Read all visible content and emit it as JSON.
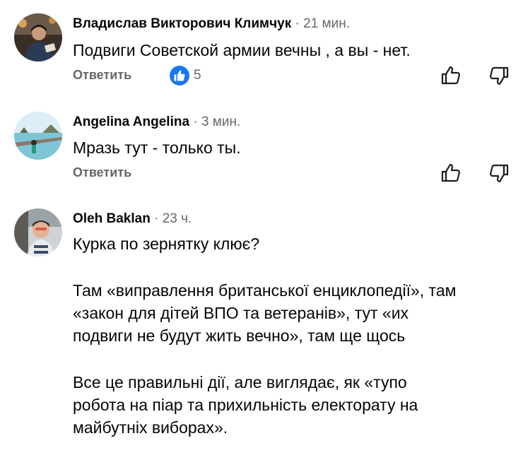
{
  "comments": [
    {
      "author": "Владислав Викторович Климчук",
      "separator": "·",
      "time": "21 мин.",
      "text": "Подвиги Советской армии вечны , а вы - нет.",
      "reply_label": "Ответить",
      "reaction_count": "5",
      "reaction_icon": "like-icon",
      "avatar_icon": "user-photo"
    },
    {
      "author": "Angelina Angelina",
      "separator": "·",
      "time": "3 мин.",
      "text": "Мразь тут - только ты.",
      "reply_label": "Ответить",
      "avatar_icon": "beach-photo"
    },
    {
      "author": "Oleh Baklan",
      "separator": "·",
      "time": "23 ч.",
      "paragraphs": [
        "Курка по зернятку клює?",
        "Там «виправлення британської енциклопедії», там\n«закон для дітей ВПО та ветеранів», тут «их\nподвиги не будут жить вечно», там ще щось",
        "Все це правильні дії, але виглядає, як «тупо\nробота на піар та прихильність електорату на\nмайбутніх виборах»."
      ],
      "avatar_icon": "user-photo"
    }
  ],
  "icons": {
    "upvote": "thumbs-up-outline-icon",
    "downvote": "thumbs-down-outline-icon"
  },
  "colors": {
    "accent": "#1877f2",
    "secondary_text": "#65676b",
    "primary_text": "#050505"
  }
}
